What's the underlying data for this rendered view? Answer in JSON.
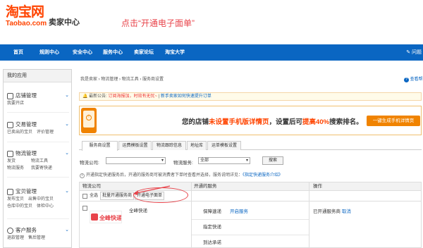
{
  "header": {
    "logo_cn": "淘宝网",
    "logo_en": "Taobao.com",
    "seller_center": "卖家中心",
    "annotation": "点击“开通电子面单”"
  },
  "nav": {
    "items": [
      "首页",
      "规则中心",
      "安全中心",
      "服务中心",
      "卖家论坛",
      "淘宝大学"
    ],
    "right": "问题"
  },
  "sidebar": {
    "title": "我的应用",
    "groups": [
      {
        "title": "店铺管理",
        "lines": [
          [
            "我要开店"
          ]
        ]
      },
      {
        "title": "交易管理",
        "lines": [
          [
            "已卖出的宝贝",
            "评价管理"
          ]
        ]
      },
      {
        "title": "物流管理",
        "lines": [
          [
            "发货",
            "物流工具"
          ],
          [
            "物流服务",
            "我要寄快递"
          ]
        ]
      },
      {
        "title": "宝贝管理",
        "lines": [
          [
            "发布宝贝",
            "出售中的宝贝"
          ],
          [
            "仓库中的宝贝",
            "体检中心"
          ]
        ]
      },
      {
        "title": "客户服务",
        "lines": [
          [
            "退款管理",
            "售后管理"
          ]
        ]
      }
    ]
  },
  "breadcrumb": "我是卖家 › 物流管理 › 物流工具 › 服务商设置",
  "help": "查看帮",
  "notice": {
    "label": "最新公告:",
    "red": "订阅海报加，时效有无忧~",
    "links": "新手卖家如何快速提升订单"
  },
  "banner": {
    "pre": "您的店铺",
    "mid": "未设置手机版详情页",
    "post": "，设置后可",
    "hi": "提高40%",
    "end": "搜索排名。",
    "button": "一键生成手机详情页"
  },
  "tabs": [
    "服务商设置",
    "运费模板设置",
    "物流跟踪信息",
    "地址库",
    "运单模板设置"
  ],
  "filter": {
    "company_label": "物流公司:",
    "service_label": "物流服务:",
    "service_value": "全部",
    "search": "搜索"
  },
  "info": {
    "text": "开通指定快递服务后，开通的服务商可被消费者下单时查看并选择，服务说明详见：",
    "link": "《指定快递服务介绍》"
  },
  "table": {
    "headers": [
      "物流公司",
      "开通的服务",
      "操作"
    ],
    "bar": {
      "select_all": "全选",
      "batch": "批量开通服务商",
      "open_ewaybill": "开通电子面单"
    },
    "row": {
      "company": "全峰快递",
      "logo_text": "全峰快递",
      "services": [
        "保障速递",
        "指定快递",
        "到达承诺"
      ],
      "open_service": "开启服务",
      "status": "已开通服务商",
      "cancel": "取消"
    }
  }
}
